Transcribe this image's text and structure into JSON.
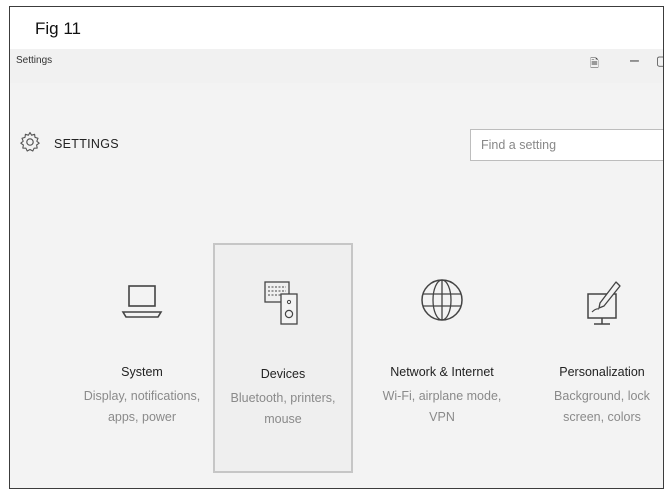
{
  "figure": {
    "label": "Fig 11"
  },
  "window": {
    "title": "Settings",
    "controls": {
      "pin": "🗎",
      "minimize": "–",
      "maximize": "▢"
    }
  },
  "header": {
    "title": "SETTINGS",
    "search_placeholder": "Find a setting",
    "icon": "gear-icon"
  },
  "tiles": [
    {
      "icon": "laptop-icon",
      "name": "System",
      "desc1": "Display, notifications,",
      "desc2": "apps, power",
      "selected": false
    },
    {
      "icon": "devices-icon",
      "name": "Devices",
      "desc1": "Bluetooth, printers,",
      "desc2": "mouse",
      "selected": true
    },
    {
      "icon": "globe-icon",
      "name": "Network & Internet",
      "desc1": "Wi-Fi, airplane mode,",
      "desc2": "VPN",
      "selected": false
    },
    {
      "icon": "personalization-icon",
      "name": "Personalization",
      "desc1": "Background, lock",
      "desc2": "screen, colors",
      "selected": false
    }
  ],
  "colors": {
    "background": "#f3f3f3",
    "text": "#222222",
    "muted": "#8a8a8a",
    "selected_border": "#c6c6c6"
  }
}
